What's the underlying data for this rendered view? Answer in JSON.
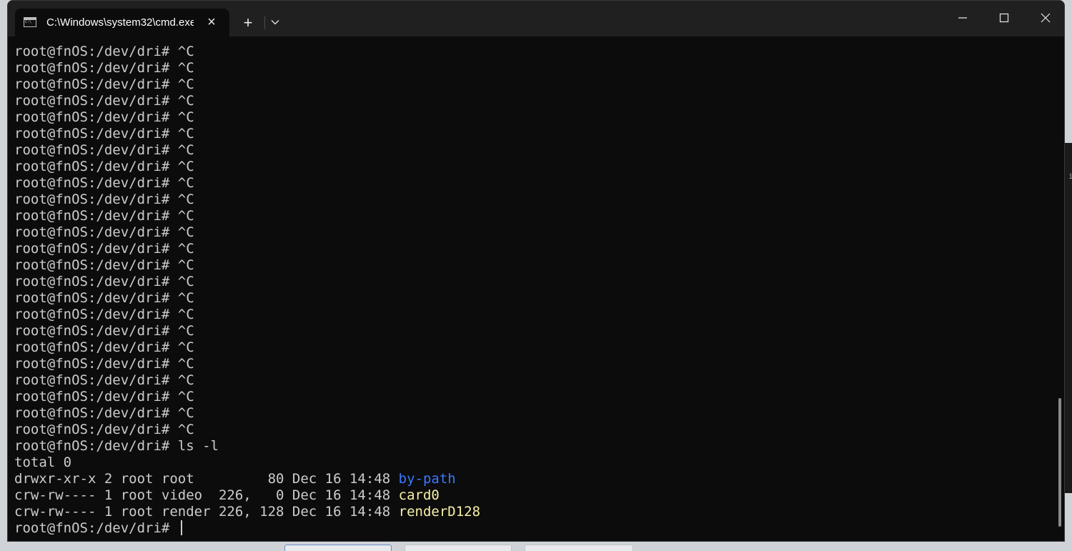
{
  "window": {
    "tab_title": "C:\\Windows\\system32\\cmd.exe",
    "new_tab_label": "+"
  },
  "terminal": {
    "prompt": "root@fnOS:/dev/dri# ",
    "ctrl_c_lines": [
      "^C",
      "^C",
      "^C",
      "^C",
      "^C",
      "^C",
      "^C",
      "^C",
      "^C",
      "^C",
      "^C",
      "^C",
      "^C",
      "^C",
      "^C",
      "^C",
      "^C",
      "^C",
      "^C",
      "^C",
      "^C",
      "^C",
      "^C",
      "^C"
    ],
    "command": "ls -l",
    "total_line": "total 0",
    "listing": [
      {
        "prefix": "drwxr-xr-x 2 root root         80 Dec 16 14:48 ",
        "name": "by-path",
        "color": "#3b78ff"
      },
      {
        "prefix": "crw-rw---- 1 root video  226,   0 Dec 16 14:48 ",
        "name": "card0",
        "color": "#f9f1a5"
      },
      {
        "prefix": "crw-rw---- 1 root render 226, 128 Dec 16 14:48 ",
        "name": "renderD128",
        "color": "#f9f1a5"
      }
    ],
    "final_prompt": "root@fnOS:/dev/dri# "
  },
  "colors": {
    "terminal_bg": "#0c0c0c",
    "terminal_fg": "#cccccc",
    "titlebar_bg": "#202020",
    "directory": "#3b78ff",
    "device": "#f9f1a5"
  },
  "icons": {
    "tab": "terminal-icon",
    "close_tab": "close-icon",
    "new_tab": "plus-icon",
    "dropdown": "chevron-down-icon",
    "minimize": "minimize-icon",
    "maximize": "maximize-icon",
    "close_window": "close-icon"
  },
  "desktop": {
    "right_edge_glyph": "i"
  }
}
